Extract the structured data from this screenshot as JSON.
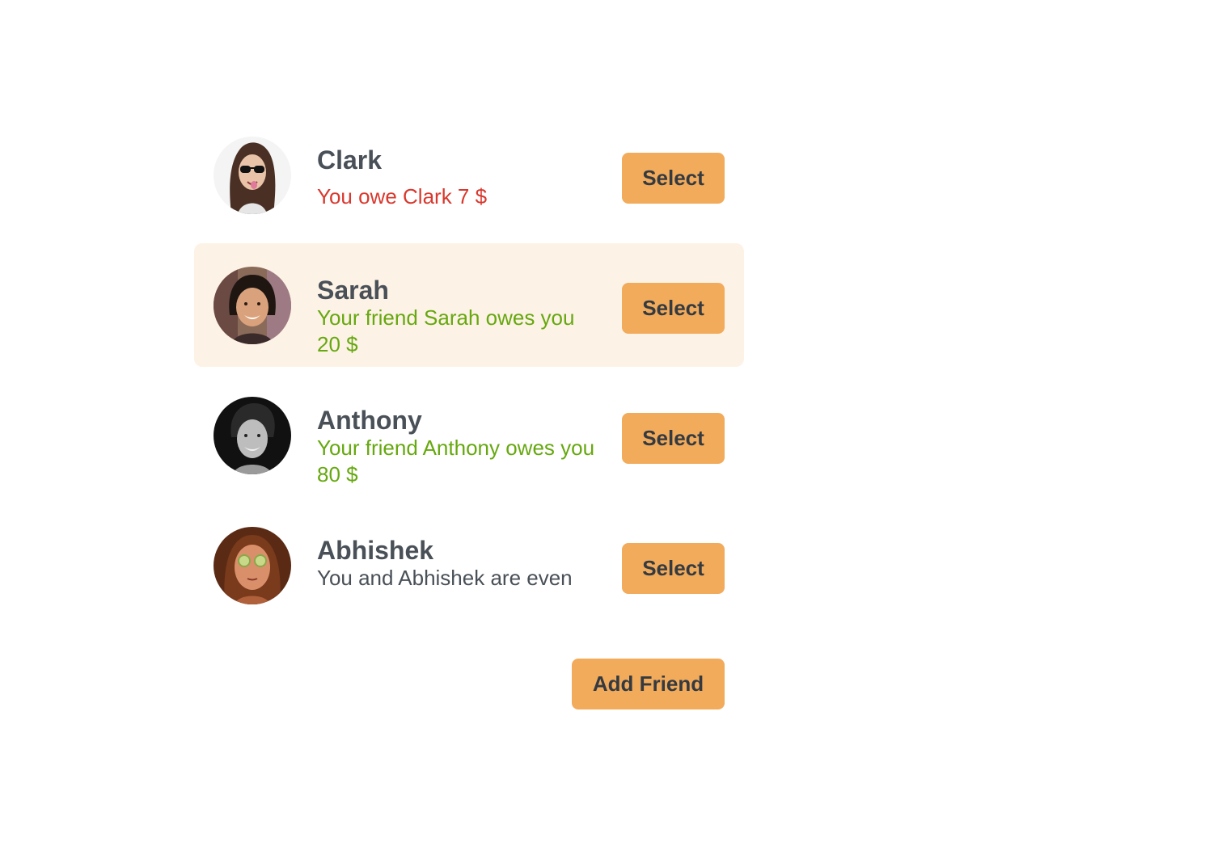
{
  "friends": [
    {
      "name": "Clark",
      "balance": "You owe Clark 7 $",
      "balance_color": "#d9382e",
      "selected": false,
      "avatar_icon": "avatar-photo-clark",
      "select_label": "Select"
    },
    {
      "name": "Sarah",
      "balance": "Your friend Sarah owes you 20 $",
      "balance_color": "#66a80f",
      "selected": true,
      "avatar_icon": "avatar-photo-sarah",
      "select_label": "Select"
    },
    {
      "name": "Anthony",
      "balance": "Your friend Anthony owes you 80 $",
      "balance_color": "#66a80f",
      "selected": false,
      "avatar_icon": "avatar-photo-anthony",
      "select_label": "Select"
    },
    {
      "name": "Abhishek",
      "balance": "You and Abhishek are even",
      "balance_color": "#495057",
      "selected": false,
      "avatar_icon": "avatar-photo-abhishek",
      "select_label": "Select"
    }
  ],
  "add_friend_label": "Add Friend",
  "colors": {
    "accent": "#f2ab5b",
    "selected_bg": "#fdf2e6",
    "owe_red": "#d9382e",
    "owed_green": "#66a80f",
    "text_dark": "#495057"
  }
}
